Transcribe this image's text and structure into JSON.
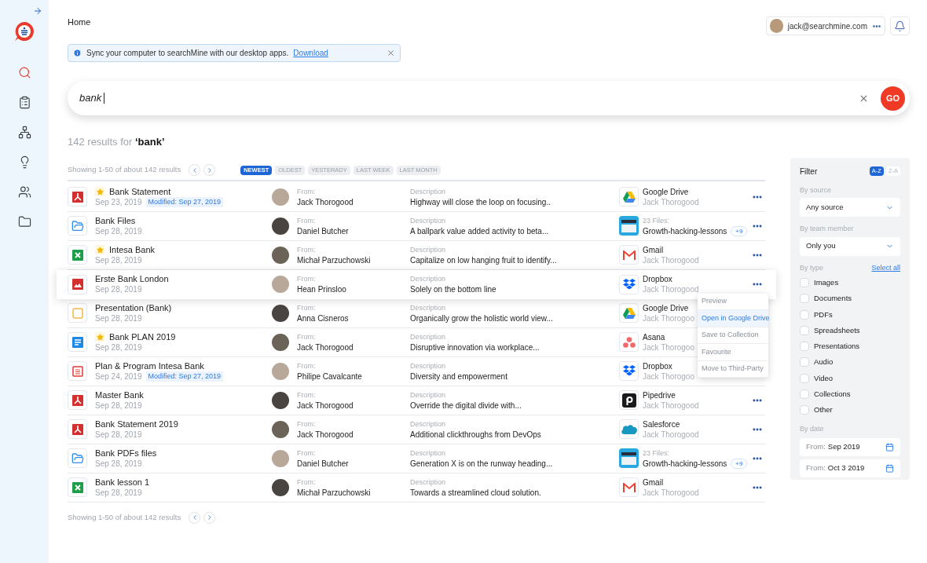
{
  "sidebar": {
    "nav": [
      {
        "kind": "search",
        "selected": true
      },
      {
        "kind": "clipboard",
        "selected": false
      },
      {
        "kind": "network",
        "selected": false
      },
      {
        "kind": "bulb",
        "selected": false
      },
      {
        "kind": "people",
        "selected": false
      },
      {
        "kind": "folder",
        "selected": false
      }
    ]
  },
  "header": {
    "breadcrumb": "Home",
    "user_email": "jack@searchmine.com"
  },
  "banner": {
    "text": "Sync your computer to searchMine with our desktop apps.",
    "link": "Download"
  },
  "search": {
    "value": "bank",
    "button": "GO"
  },
  "results_title": {
    "count": "142 results for",
    "query": "‘bank’"
  },
  "pagination_top": "Showing 1-50 of about 142 results",
  "sort_pills": [
    {
      "label": "NEWEST",
      "selected": true
    },
    {
      "label": "OLDEST",
      "selected": false
    },
    {
      "label": "YESTERADY",
      "selected": false
    },
    {
      "label": "LAST WEEK",
      "selected": false
    },
    {
      "label": "LAST MONTH",
      "selected": false
    }
  ],
  "rows": [
    {
      "kind": "pdf",
      "starred": true,
      "title": "Bank Statement",
      "date": "Sep 23, 2019",
      "modified": "Modified: Sep 27, 2019",
      "from_label": "From:",
      "from": "Jack Thorogood",
      "desc_label": "Description",
      "desc": "Highway will close the loop on focusing..",
      "source": {
        "kind": "gdrive",
        "top": "Google Drive",
        "bottom": "Jack Thorogood"
      },
      "active": false
    },
    {
      "kind": "folder",
      "starred": false,
      "title": "Bank Files",
      "date": "Sep 28, 2019",
      "from_label": "From:",
      "from": "Daniel Butcher",
      "desc_label": "Description",
      "desc": "A ballpark value added activity to beta...",
      "source": {
        "kind": "files",
        "top": "23 Files:",
        "bottom": "Growth-hacking-lessons",
        "badge": "+9"
      },
      "active": false
    },
    {
      "kind": "sheet",
      "starred": true,
      "title": "Intesa Bank",
      "date": "Sep 28, 2019",
      "from_label": "From:",
      "from": "Michał Parzuchowski",
      "desc_label": "Description",
      "desc": "Capitalize on low hanging fruit to identify...",
      "source": {
        "kind": "gmail",
        "top": "Gmail",
        "bottom": "Jack Thorogood"
      },
      "active": false
    },
    {
      "kind": "image",
      "starred": false,
      "title": "Erste Bank London",
      "date": "Sep 28, 2019",
      "from_label": "From:",
      "from": "Hean Prinsloo",
      "desc_label": "Description",
      "desc": "Solely on the bottom line",
      "source": {
        "kind": "dropbox",
        "top": "Dropbox",
        "bottom": "Jack Thorogood"
      },
      "active": true,
      "menu": [
        {
          "label": "Preview",
          "selected": false
        },
        {
          "label": "Open in Google Drive",
          "selected": true
        },
        {
          "label": "Save to Collection",
          "selected": false
        },
        {
          "label": "Favourite",
          "selected": false
        },
        {
          "label": "Move to Third-Party",
          "selected": false
        }
      ]
    },
    {
      "kind": "presentation",
      "starred": false,
      "title": "Presentation (Bank)",
      "date": "Sep 28, 2019",
      "from_label": "From:",
      "from": "Anna Cisneros",
      "desc_label": "Description",
      "desc": "Organically grow the holistic world view...",
      "source": {
        "kind": "gdrive",
        "top": "Google Drive",
        "bottom": "Jack Thorogoo"
      },
      "active": false
    },
    {
      "kind": "doc",
      "starred": true,
      "title": "Bank PLAN 2019",
      "date": "Sep 28, 2019",
      "from_label": "From:",
      "from": "Jack Thorogood",
      "desc_label": "Description",
      "desc": "Disruptive innovation via workplace...",
      "source": {
        "kind": "asana",
        "top": "Asana",
        "bottom": "Jack Thorogoo"
      },
      "active": false
    },
    {
      "kind": "slides",
      "starred": false,
      "title": "Plan & Program Intesa Bank",
      "date": "Sep 24, 2019",
      "modified": "Modified: Sep 27, 2019",
      "from_label": "From:",
      "from": "Philipe Cavalcante",
      "desc_label": "Description",
      "desc": "Diversity and empowerment",
      "source": {
        "kind": "dropbox",
        "top": "Dropbox",
        "bottom": "Jack Thorogoo"
      },
      "active": false
    },
    {
      "kind": "pdf",
      "starred": false,
      "title": "Master Bank",
      "date": "Sep 28, 2019",
      "from_label": "From:",
      "from": "Jack Thorogood",
      "desc_label": "Description",
      "desc": "Override the digital divide with...",
      "source": {
        "kind": "pipedrive",
        "top": "Pipedrive",
        "bottom": "Jack Thorogood"
      },
      "active": false
    },
    {
      "kind": "pdf",
      "starred": false,
      "title": "Bank Statement 2019",
      "date": "Sep 28, 2019",
      "from_label": "From:",
      "from": "Jack Thorogood",
      "desc_label": "Description",
      "desc": "Additional clickthroughs from DevOps",
      "source": {
        "kind": "salesforce",
        "top": "Salesforce",
        "bottom": "Jack Thorogood"
      },
      "active": false
    },
    {
      "kind": "folder",
      "starred": false,
      "title": "Bank PDFs files",
      "date": "Sep 28, 2019",
      "from_label": "From:",
      "from": "Daniel Butcher",
      "desc_label": "Description",
      "desc": "Generation X is on the runway heading...",
      "source": {
        "kind": "files",
        "top": "23 Files:",
        "bottom": "Growth-hacking-lessons",
        "badge": "+9"
      },
      "active": false
    },
    {
      "kind": "sheet",
      "starred": false,
      "title": "Bank lesson 1",
      "date": "Sep 28, 2019",
      "from_label": "From:",
      "from": "Michał Parzuchowski",
      "desc_label": "Description",
      "desc": "Towards a streamlined cloud solution.",
      "source": {
        "kind": "gmail",
        "top": "Gmail",
        "bottom": "Jack Thorogood"
      },
      "active": false
    }
  ],
  "pagination_bottom": "Showing 1-50 of about 142 results",
  "filter": {
    "title": "Filter",
    "sort": [
      {
        "label": "A-Z",
        "selected": true
      },
      {
        "label": "Z-A",
        "selected": false
      }
    ],
    "source_label": "By source",
    "source_value": "Any source",
    "team_label": "By team member",
    "team_value": "Only you",
    "type_label": "By type",
    "select_all": "Select all",
    "types": [
      {
        "label": "Images",
        "checked": false
      },
      {
        "label": "Documents",
        "checked": false
      },
      {
        "label": "PDFs",
        "checked": false
      },
      {
        "label": "Spreadsheets",
        "checked": false
      },
      {
        "label": "Presentations",
        "checked": false
      },
      {
        "label": "Audio",
        "checked": false
      },
      {
        "label": "Video",
        "checked": false
      },
      {
        "label": "Collections",
        "checked": false
      },
      {
        "label": "Other",
        "checked": false
      }
    ],
    "date_label": "By date",
    "dates": [
      {
        "label": "From:",
        "value": "Sep 2019"
      },
      {
        "label": "From:",
        "value": "Oct 3 2019"
      }
    ]
  }
}
